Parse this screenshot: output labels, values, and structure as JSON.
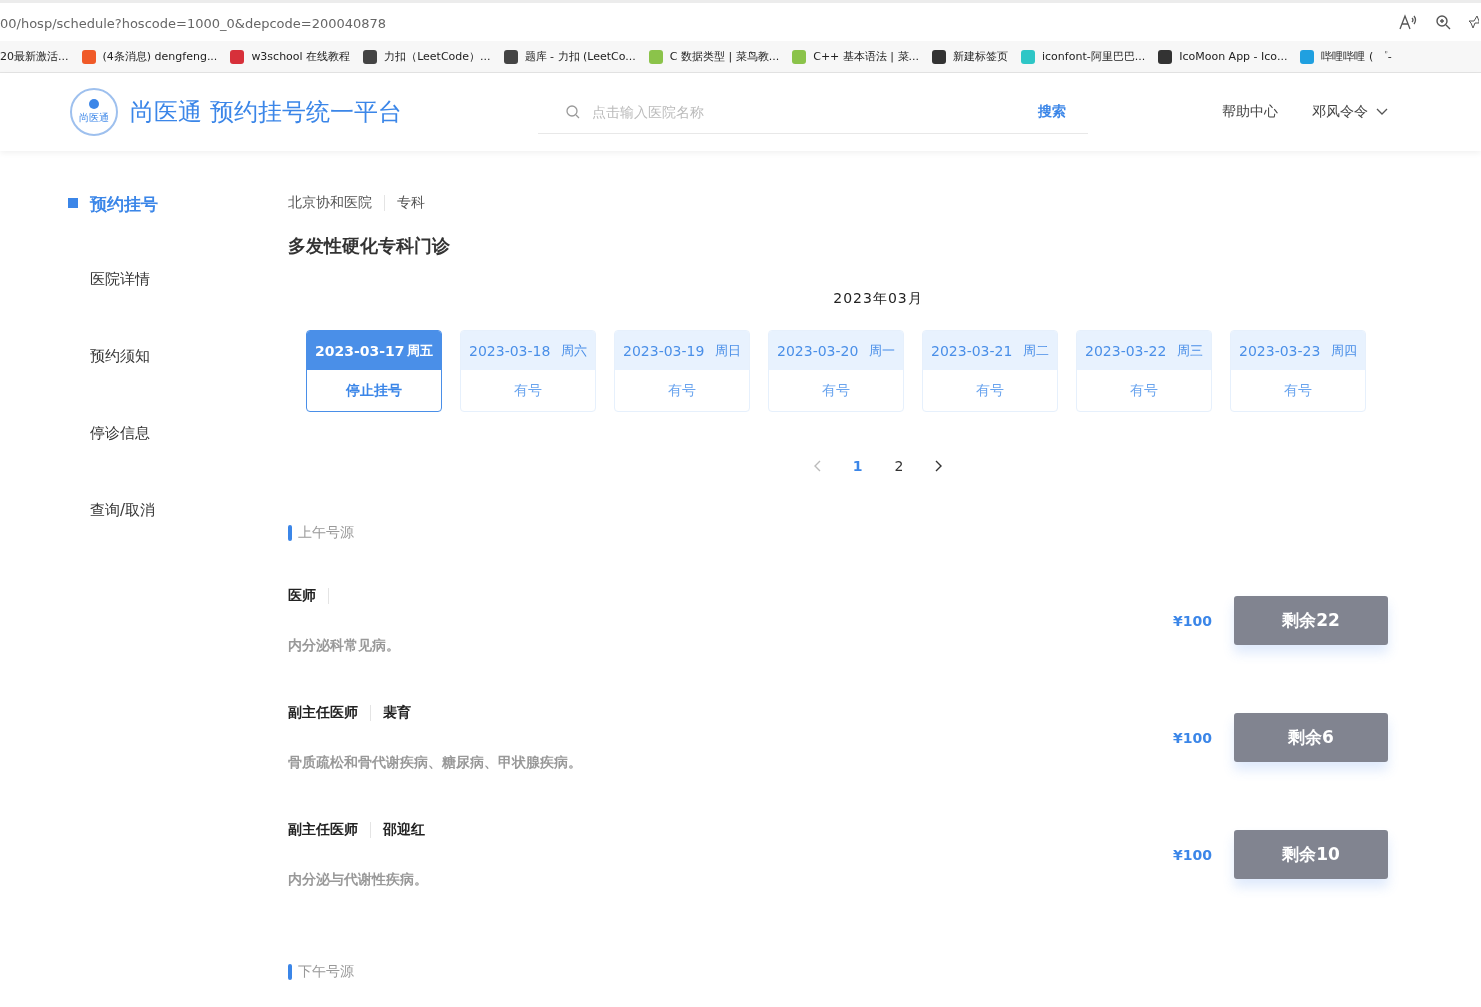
{
  "browser": {
    "url": "00/hosp/schedule?hoscode=1000_0&depcode=200040878",
    "bookmarks": [
      "20最新激活...",
      "(4条消息) dengfeng...",
      "w3school 在线教程",
      "力扣（LeetCode）...",
      "题库 - 力扣 (LeetCo...",
      "C 数据类型 | 菜鸟教...",
      "C++ 基本语法 | 菜...",
      "新建标签页",
      "iconfont-阿里巴巴...",
      "IcoMoon App - Ico...",
      "哔哩哔哩 ( ゜-"
    ]
  },
  "header": {
    "logo_badge": "尚医通",
    "title": "尚医通 预约挂号统一平台",
    "search": {
      "placeholder": "点击输入医院名称",
      "button": "搜索"
    },
    "help": "帮助中心",
    "user": "邓风令令"
  },
  "sidebar": {
    "items": [
      {
        "label": "预约挂号",
        "selected": true
      },
      {
        "label": "医院详情",
        "selected": false
      },
      {
        "label": "预约须知",
        "selected": false
      },
      {
        "label": "停诊信息",
        "selected": false
      },
      {
        "label": "查询/取消",
        "selected": false
      }
    ]
  },
  "breadcrumb": [
    "北京协和医院",
    "专科"
  ],
  "department": "多发性硬化专科门诊",
  "month": "2023年03月",
  "dates": [
    {
      "date": "2023-03-17",
      "weekday": "周五",
      "status": "停止挂号",
      "selected": true
    },
    {
      "date": "2023-03-18",
      "weekday": "周六",
      "status": "有号",
      "selected": false
    },
    {
      "date": "2023-03-19",
      "weekday": "周日",
      "status": "有号",
      "selected": false
    },
    {
      "date": "2023-03-20",
      "weekday": "周一",
      "status": "有号",
      "selected": false
    },
    {
      "date": "2023-03-21",
      "weekday": "周二",
      "status": "有号",
      "selected": false
    },
    {
      "date": "2023-03-22",
      "weekday": "周三",
      "status": "有号",
      "selected": false
    },
    {
      "date": "2023-03-23",
      "weekday": "周四",
      "status": "有号",
      "selected": false
    }
  ],
  "pagination": {
    "pages": [
      {
        "label": "1",
        "selected": true
      },
      {
        "label": "2",
        "selected": false
      }
    ]
  },
  "sections": [
    {
      "title": "上午号源",
      "doctors": [
        {
          "title": "医师",
          "description": "内分泌科常见病。",
          "price": "¥100",
          "remaining": "剩余22"
        },
        {
          "title": "副主任医师",
          "name": "裴育",
          "description": "骨质疏松和骨代谢疾病、糖尿病、甲状腺疾病。",
          "price": "¥100",
          "remaining": "剩余6"
        },
        {
          "title": "副主任医师",
          "name": "邵迎红",
          "description": "内分泌与代谢性疾病。",
          "price": "¥100",
          "remaining": "剩余10"
        }
      ]
    },
    {
      "title": "下午号源"
    }
  ]
}
